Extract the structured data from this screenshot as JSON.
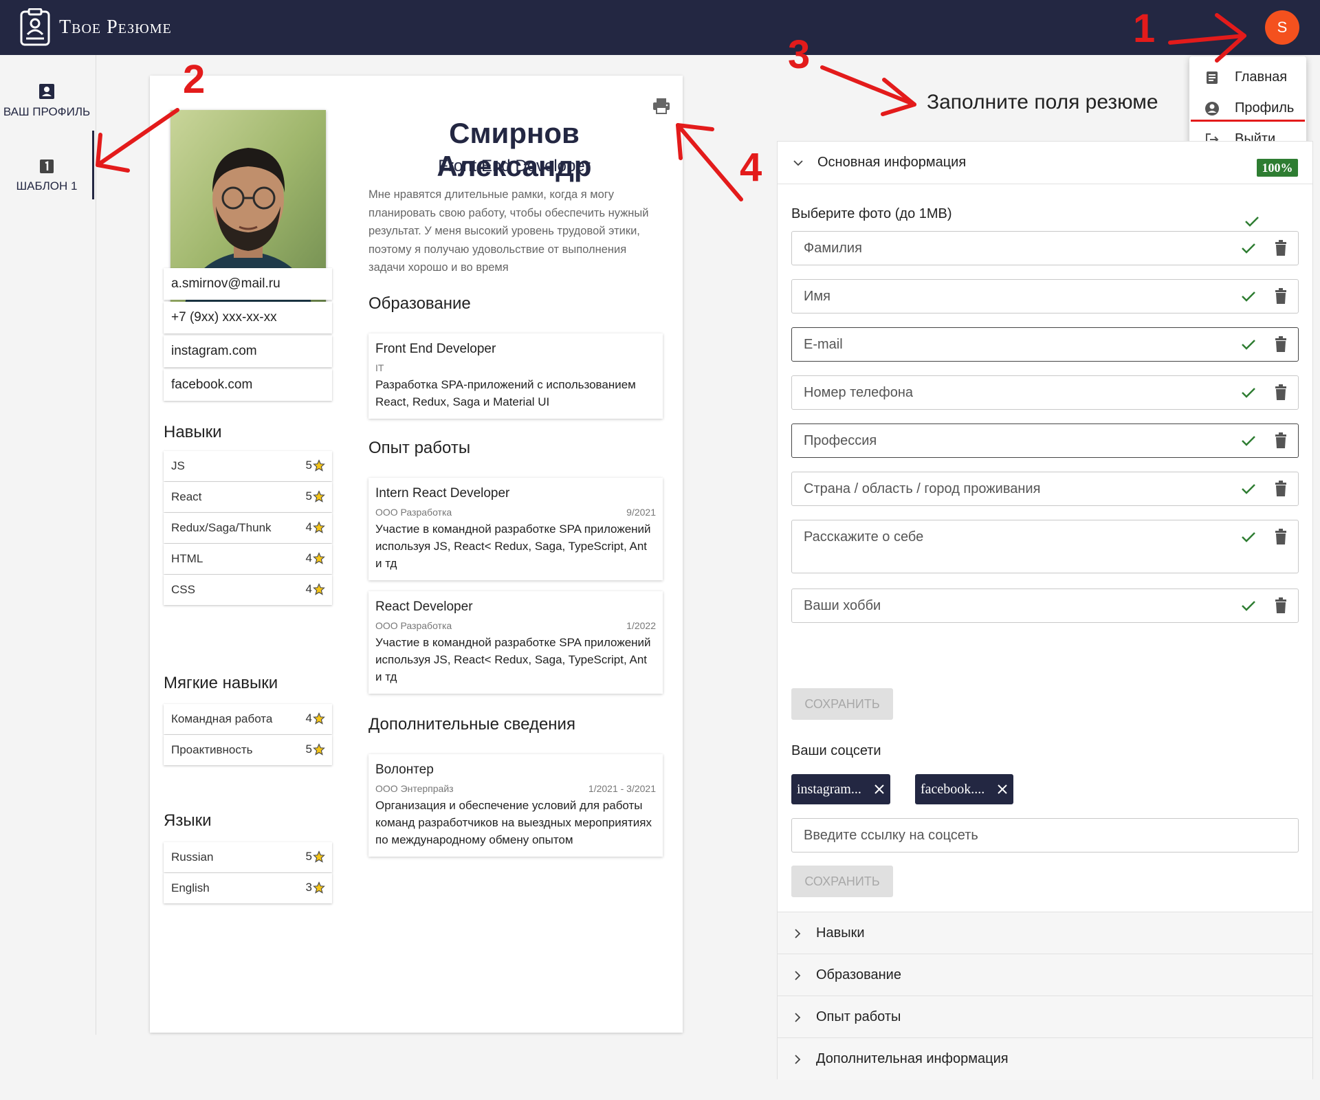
{
  "app": {
    "title": "Твое Резюме",
    "avatar_letter": "S",
    "brand_color": "#232742",
    "avatar_color": "#f4511e"
  },
  "menu": {
    "items": [
      {
        "label": "Главная",
        "icon": "article-icon"
      },
      {
        "label": "Профиль",
        "icon": "account-circle-icon"
      },
      {
        "label": "Выйти",
        "icon": "logout-icon"
      }
    ]
  },
  "rail": {
    "items": [
      {
        "label": "Ваш профиль",
        "icon": "profile-card-icon"
      },
      {
        "label": "Шаблон 1",
        "icon": "number-one-box-icon"
      }
    ]
  },
  "resume": {
    "name": "Смирнов Александр",
    "role": "Front End Developer",
    "about": "Мне нравятся длительные рамки, когда я могу планировать свою работу, чтобы обеспечить нужный результат. У меня высокий уровень трудовой этики, поэтому я получаю удовольствие от выполнения задачи хорошо и во время",
    "contacts": [
      "a.smirnov@mail.ru",
      "+7 (9xx) xxx-xx-xx",
      "instagram.com",
      "facebook.com"
    ],
    "skills_title": "Навыки",
    "skills": [
      {
        "name": "JS",
        "level": "5"
      },
      {
        "name": "React",
        "level": "5"
      },
      {
        "name": "Redux/Saga/Thunk",
        "level": "4"
      },
      {
        "name": "HTML",
        "level": "4"
      },
      {
        "name": "CSS",
        "level": "4"
      }
    ],
    "soft_title": "Мягкие навыки",
    "soft_skills": [
      {
        "name": "Командная работа",
        "level": "4"
      },
      {
        "name": "Проактивность",
        "level": "5"
      }
    ],
    "lang_title": "Языки",
    "languages": [
      {
        "name": "Russian",
        "level": "5"
      },
      {
        "name": "English",
        "level": "3"
      }
    ],
    "education_title": "Образование",
    "education": [
      {
        "title": "Front End Developer",
        "org": "IT",
        "date": "",
        "desc": "Разработка SPA-приложений с использованием React, Redux, Saga и Material UI"
      }
    ],
    "experience_title": "Опыт работы",
    "experience": [
      {
        "title": "Intern React Developer",
        "org": "ООО Разработка",
        "date": "9/2021",
        "desc": "Участие в командной разработке SPA приложений используя JS, React< Redux, Saga, TypeScript, Ant и тд"
      },
      {
        "title": "React Developer",
        "org": "ООО Разработка",
        "date": "1/2022",
        "desc": "Участие в командной разработке SPA приложений используя JS, React< Redux, Saga, TypeScript, Ant и тд"
      }
    ],
    "extra_title": "Дополнительные сведения",
    "extra": [
      {
        "title": "Волонтер",
        "org": "ООО Энтерпрайз",
        "date": "1/2021 - 3/2021",
        "desc": "Организация и обеспечение условий для работы команд разработчиков на выездных мероприятиях по международному обмену опытом"
      }
    ]
  },
  "form": {
    "heading": "Заполните поля резюме",
    "section_main": "Основная информация",
    "progress": "100%",
    "photo_label": "Выберите фото (до 1MB)",
    "fields": [
      "Фамилия",
      "Имя",
      "E-mail",
      "Номер телефона",
      "Профессия",
      "Страна / область / город проживания",
      "Расскажите о себе",
      "Ваши хобби"
    ],
    "save_label": "СОХРАНИТЬ",
    "social_label": "Ваши соцсети",
    "chips": [
      "instagram...",
      "facebook...."
    ],
    "social_placeholder": "Введите ссылку на соцсеть",
    "sections": [
      "Навыки",
      "Образование",
      "Опыт работы",
      "Дополнительная информация"
    ]
  },
  "annotations": [
    "1",
    "2",
    "3",
    "4"
  ],
  "colors": {
    "annotation": "#e31b1b",
    "success": "#2e7d32",
    "star": "#f5c518"
  }
}
